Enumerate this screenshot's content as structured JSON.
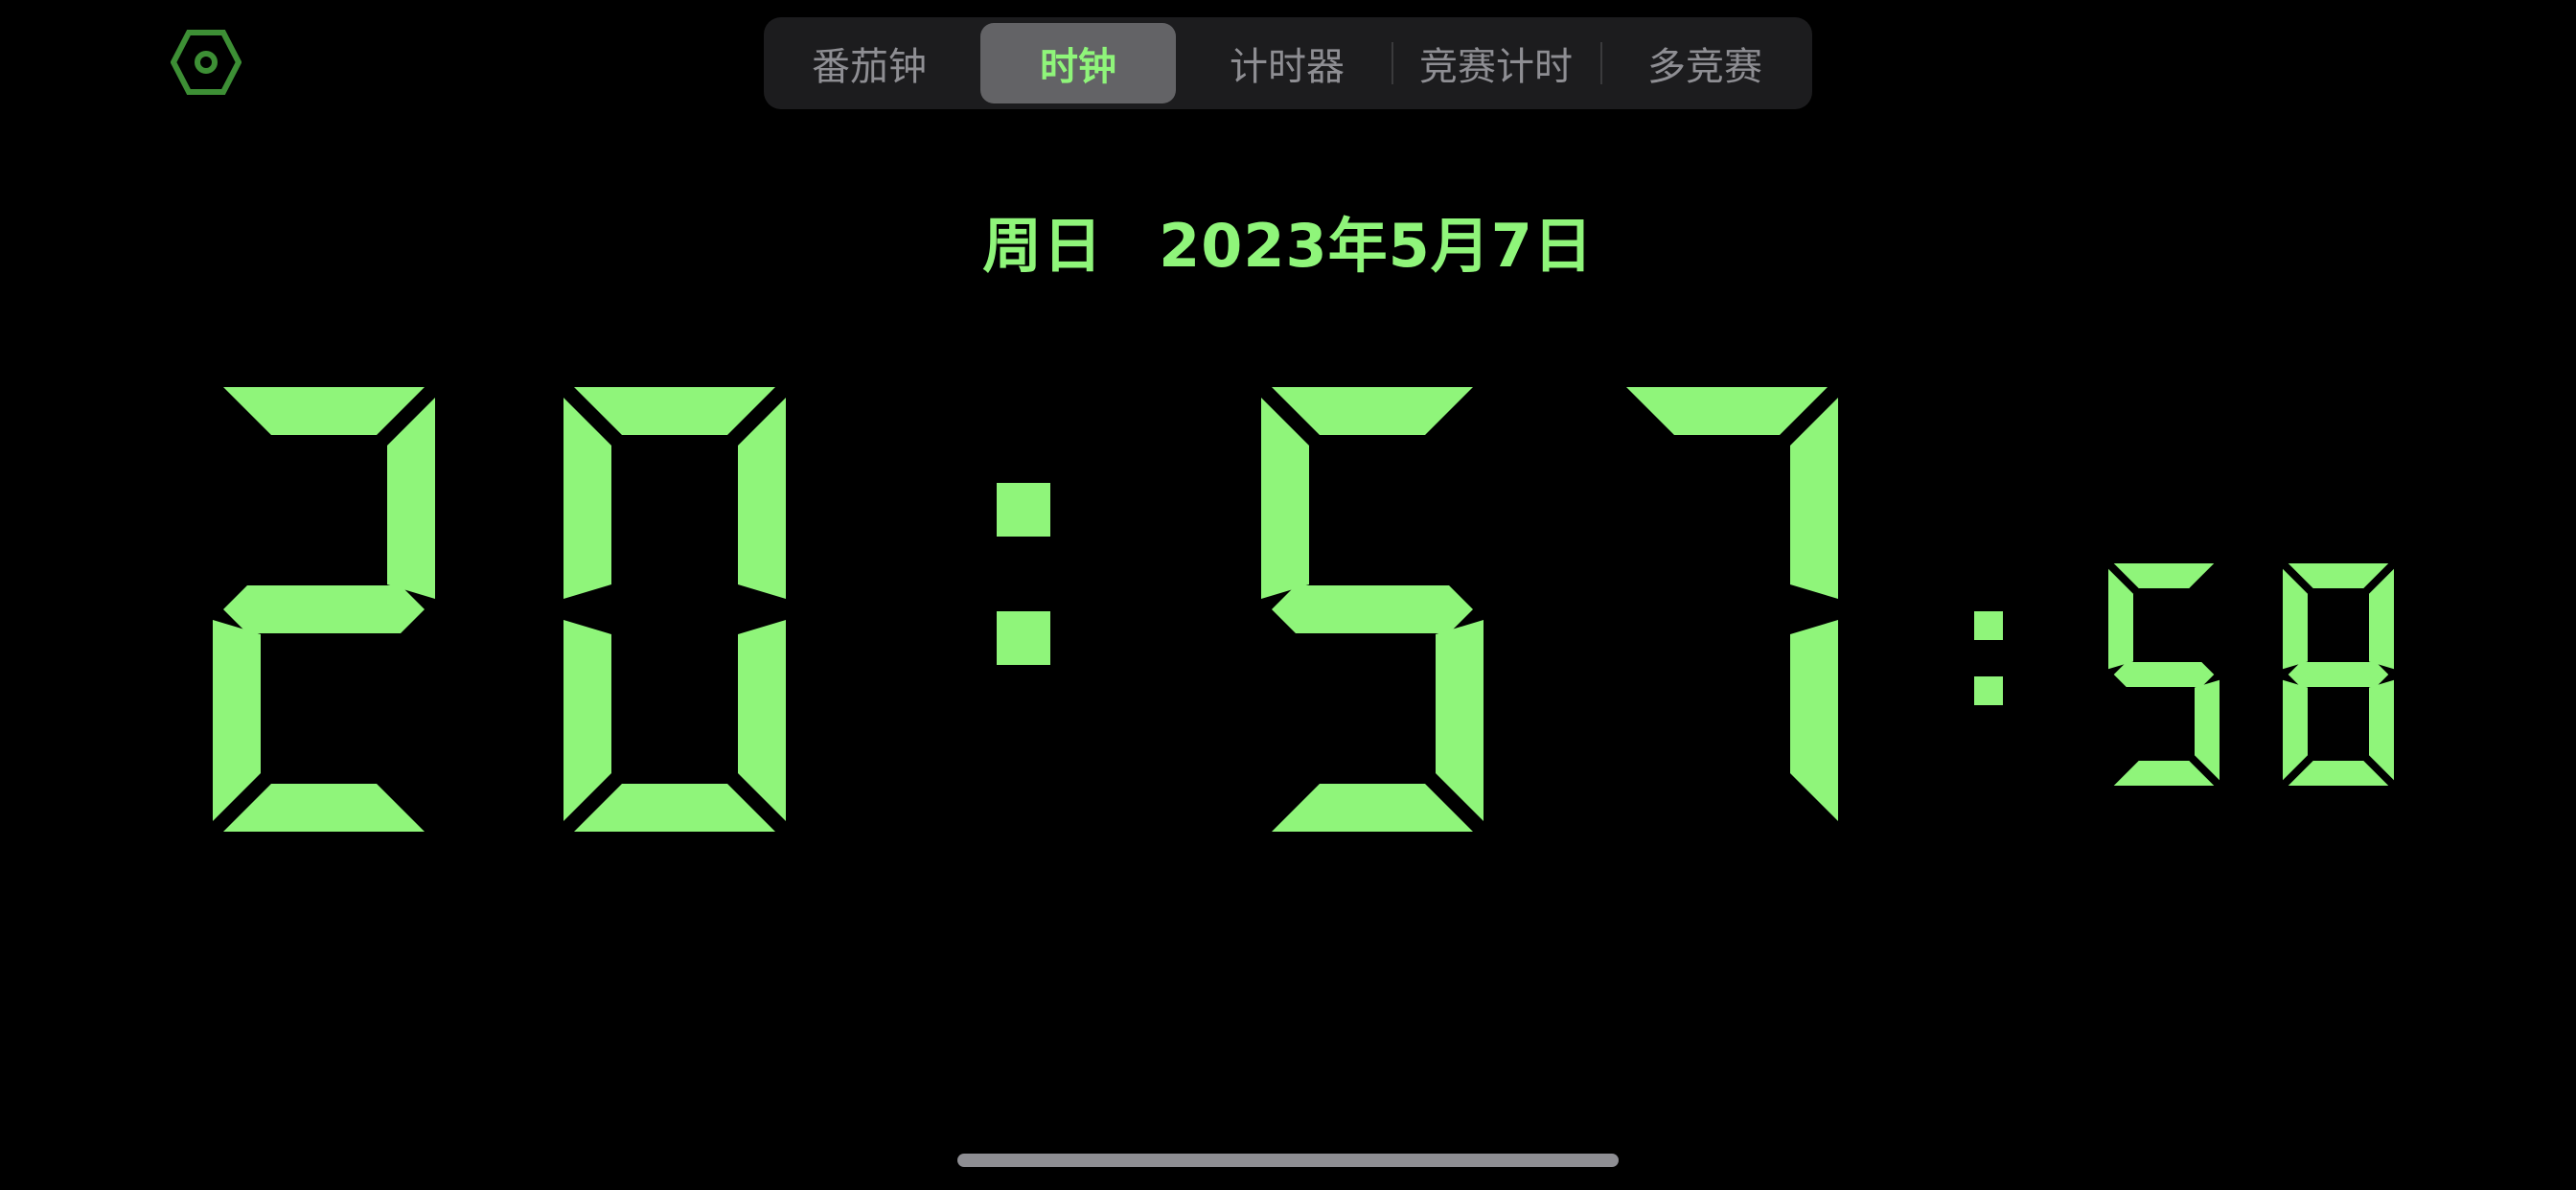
{
  "theme": {
    "accent": "#8ff57a",
    "background": "#000000",
    "inactive_text": "#8e8e93",
    "segment_bg": "#1c1c1e",
    "active_segment_bg": "#636366"
  },
  "settings": {
    "icon": "hexagon-settings-icon"
  },
  "tabs": [
    {
      "label": "番茄钟",
      "active": false
    },
    {
      "label": "时钟",
      "active": true
    },
    {
      "label": "计时器",
      "active": false
    },
    {
      "label": "竞赛计时",
      "active": false
    },
    {
      "label": "多竞赛",
      "active": false
    }
  ],
  "date": {
    "weekday": "周日",
    "date": "2023年5月7日"
  },
  "time": {
    "hours": "20",
    "minutes": "57",
    "seconds": "58"
  }
}
